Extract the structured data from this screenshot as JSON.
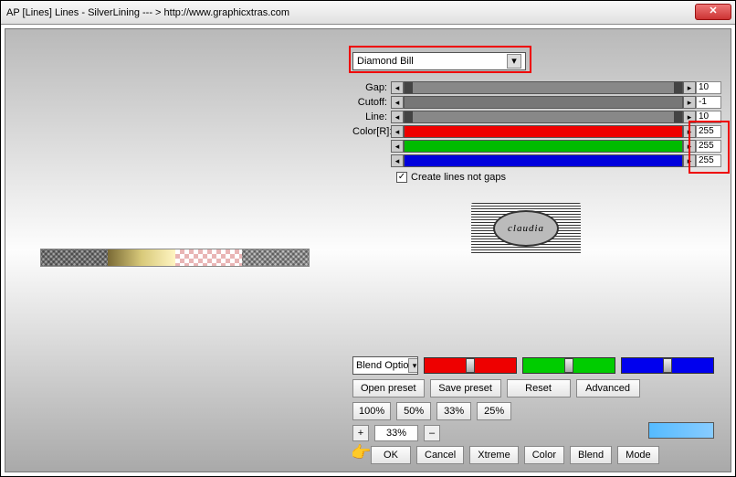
{
  "title": "AP [Lines]  Lines - SilverLining    --- >  http://www.graphicxtras.com",
  "preset": "Diamond Bill",
  "sliders": {
    "gap": {
      "label": "Gap:",
      "value": "10"
    },
    "cutoff": {
      "label": "Cutoff:",
      "value": "-1"
    },
    "line": {
      "label": "Line:",
      "value": "10"
    },
    "colorR": {
      "label": "Color[R]:",
      "value": "255"
    },
    "colorG": {
      "label": "",
      "value": "255"
    },
    "colorB": {
      "label": "",
      "value": "255"
    }
  },
  "checkbox": {
    "label": "Create lines not gaps",
    "checked": "✓"
  },
  "logo": "claudia",
  "blendOptions": "Blend Optio",
  "buttons": {
    "openPreset": "Open preset",
    "savePreset": "Save preset",
    "reset": "Reset",
    "advanced": "Advanced",
    "p100": "100%",
    "p50": "50%",
    "p33": "33%",
    "p25": "25%",
    "plus": "+",
    "zoom": "33%",
    "minus": "–",
    "ok": "OK",
    "cancel": "Cancel",
    "xtreme": "Xtreme",
    "color": "Color",
    "blend": "Blend",
    "mode": "Mode"
  }
}
